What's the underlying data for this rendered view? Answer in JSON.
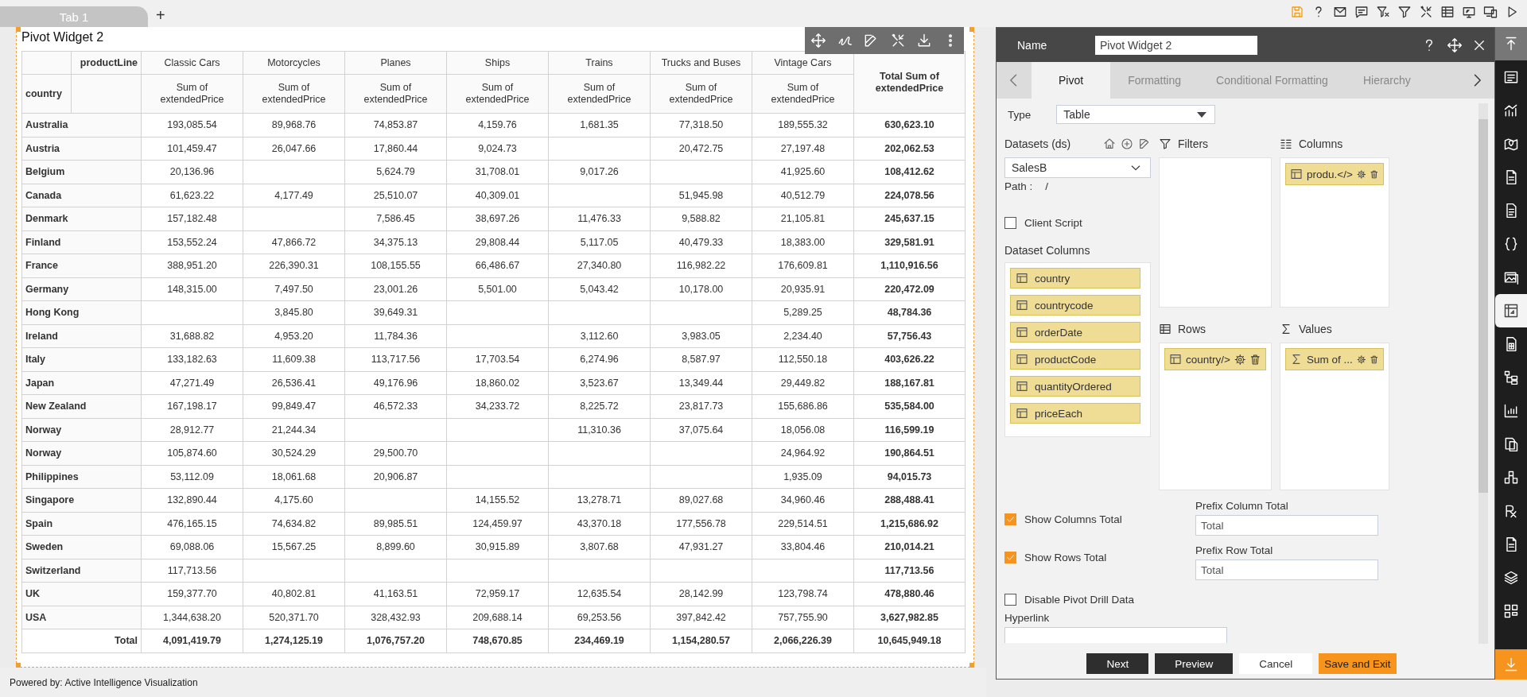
{
  "top_tabs": [
    {
      "label": "Tab 1",
      "selected": true
    }
  ],
  "add_tab": "+",
  "widget": {
    "title": "Pivot Widget 2",
    "pivot": {
      "column_field": "productLine",
      "row_field": "country",
      "columns": [
        {
          "name": "Classic Cars",
          "measure": "Sum of extendedPrice"
        },
        {
          "name": "Motorcycles",
          "measure": "Sum of extendedPrice"
        },
        {
          "name": "Planes",
          "measure": "Sum of extendedPrice"
        },
        {
          "name": "Ships",
          "measure": "Sum of extendedPrice"
        },
        {
          "name": "Trains",
          "measure": "Sum of extendedPrice"
        },
        {
          "name": "Trucks and Buses",
          "measure": "Sum of extendedPrice"
        },
        {
          "name": "Vintage Cars",
          "measure": "Sum of extendedPrice"
        }
      ],
      "total_header": "Total Sum of extendedPrice",
      "rows": [
        {
          "label": "Australia",
          "cells": [
            {
              "value": "193,085.54"
            },
            {
              "value": "89,968.76"
            },
            {
              "value": "74,853.87"
            },
            {
              "value": "4,159.76"
            },
            {
              "value": "1,681.35"
            },
            {
              "value": "77,318.50"
            },
            {
              "value": "189,555.32"
            }
          ],
          "total": "630,623.10"
        },
        {
          "label": "Austria",
          "cells": [
            {
              "value": "101,459.47"
            },
            {
              "value": "26,047.66"
            },
            {
              "value": "17,860.44"
            },
            {
              "value": "9,024.73"
            },
            {
              "kind": "empty"
            },
            {
              "value": "20,472.75"
            },
            {
              "value": "27,197.48"
            }
          ],
          "total": "202,062.53"
        },
        {
          "label": "Belgium",
          "cells": [
            {
              "value": "20,136.96"
            },
            {
              "kind": "empty"
            },
            {
              "value": "5,624.79"
            },
            {
              "value": "31,708.01"
            },
            {
              "value": "9,017.26"
            },
            {
              "kind": "empty"
            },
            {
              "value": "41,925.60"
            }
          ],
          "total": "108,412.62"
        },
        {
          "label": "Canada",
          "cells": [
            {
              "value": "61,623.22"
            },
            {
              "value": "4,177.49"
            },
            {
              "value": "25,510.07"
            },
            {
              "value": "40,309.01"
            },
            {
              "kind": "empty"
            },
            {
              "value": "51,945.98"
            },
            {
              "value": "40,512.79"
            }
          ],
          "total": "224,078.56"
        },
        {
          "label": "Denmark",
          "cells": [
            {
              "value": "157,182.48"
            },
            {
              "kind": "empty"
            },
            {
              "value": "7,586.45"
            },
            {
              "value": "38,697.26"
            },
            {
              "value": "11,476.33"
            },
            {
              "value": "9,588.82"
            },
            {
              "value": "21,105.81"
            }
          ],
          "total": "245,637.15"
        },
        {
          "label": "Finland",
          "cells": [
            {
              "value": "153,552.24"
            },
            {
              "value": "47,866.72"
            },
            {
              "value": "34,375.13"
            },
            {
              "value": "29,808.44"
            },
            {
              "value": "5,117.05"
            },
            {
              "value": "40,479.33"
            },
            {
              "value": "18,383.00"
            }
          ],
          "total": "329,581.91"
        },
        {
          "label": "France",
          "cells": [
            {
              "value": "388,951.20"
            },
            {
              "value": "226,390.31"
            },
            {
              "value": "108,155.55"
            },
            {
              "value": "66,486.67"
            },
            {
              "value": "27,340.80"
            },
            {
              "value": "116,982.22"
            },
            {
              "value": "176,609.81"
            }
          ],
          "total": "1,110,916.56"
        },
        {
          "label": "Germany",
          "cells": [
            {
              "value": "148,315.00"
            },
            {
              "value": "7,497.50"
            },
            {
              "value": "23,001.26"
            },
            {
              "value": "5,501.00"
            },
            {
              "value": "5,043.42"
            },
            {
              "value": "10,178.00"
            },
            {
              "value": "20,935.91"
            }
          ],
          "total": "220,472.09"
        },
        {
          "label": "Hong Kong",
          "cells": [
            {
              "kind": "empty"
            },
            {
              "value": "3,845.80"
            },
            {
              "value": "39,649.31"
            },
            {
              "kind": "empty"
            },
            {
              "kind": "empty"
            },
            {
              "kind": "empty"
            },
            {
              "value": "5,289.25"
            }
          ],
          "total": "48,784.36"
        },
        {
          "label": "Ireland",
          "cells": [
            {
              "value": "31,688.82"
            },
            {
              "value": "4,953.20"
            },
            {
              "value": "11,784.36"
            },
            {
              "kind": "empty"
            },
            {
              "value": "3,112.60"
            },
            {
              "value": "3,983.05"
            },
            {
              "value": "2,234.40"
            }
          ],
          "total": "57,756.43"
        },
        {
          "label": "Italy",
          "cells": [
            {
              "value": "133,182.63"
            },
            {
              "value": "11,609.38"
            },
            {
              "value": "113,717.56"
            },
            {
              "value": "17,703.54"
            },
            {
              "value": "6,274.96"
            },
            {
              "value": "8,587.97"
            },
            {
              "value": "112,550.18"
            }
          ],
          "total": "403,626.22"
        },
        {
          "label": "Japan",
          "cells": [
            {
              "value": "47,271.49"
            },
            {
              "value": "26,536.41"
            },
            {
              "value": "49,176.96"
            },
            {
              "value": "18,860.02"
            },
            {
              "value": "3,523.67"
            },
            {
              "value": "13,349.44"
            },
            {
              "value": "29,449.82"
            }
          ],
          "total": "188,167.81"
        },
        {
          "label": "New Zealand",
          "cells": [
            {
              "value": "167,198.17"
            },
            {
              "value": "99,849.47"
            },
            {
              "value": "46,572.33"
            },
            {
              "value": "34,233.72"
            },
            {
              "value": "8,225.72"
            },
            {
              "value": "23,817.73"
            },
            {
              "value": "155,686.86"
            }
          ],
          "total": "535,584.00"
        },
        {
          "label": "Norway",
          "cells": [
            {
              "value": "28,912.77"
            },
            {
              "value": "21,244.34"
            },
            {
              "kind": "empty"
            },
            {
              "kind": "empty"
            },
            {
              "value": "11,310.36"
            },
            {
              "value": "37,075.64"
            },
            {
              "value": "18,056.08"
            }
          ],
          "total": "116,599.19"
        },
        {
          "label": "Norway",
          "cells": [
            {
              "value": "105,874.60"
            },
            {
              "value": "30,524.29"
            },
            {
              "value": "29,500.70"
            },
            {
              "kind": "empty"
            },
            {
              "kind": "empty"
            },
            {
              "kind": "empty"
            },
            {
              "value": "24,964.92"
            }
          ],
          "total": "190,864.51"
        },
        {
          "label": "Philippines",
          "cells": [
            {
              "value": "53,112.09"
            },
            {
              "value": "18,061.68"
            },
            {
              "value": "20,906.87"
            },
            {
              "kind": "empty"
            },
            {
              "kind": "empty"
            },
            {
              "kind": "empty"
            },
            {
              "value": "1,935.09"
            }
          ],
          "total": "94,015.73"
        },
        {
          "label": "Singapore",
          "cells": [
            {
              "value": "132,890.44"
            },
            {
              "value": "4,175.60"
            },
            {
              "kind": "empty"
            },
            {
              "value": "14,155.52"
            },
            {
              "value": "13,278.71"
            },
            {
              "value": "89,027.68"
            },
            {
              "value": "34,960.46"
            }
          ],
          "total": "288,488.41"
        },
        {
          "label": "Spain",
          "cells": [
            {
              "value": "476,165.15"
            },
            {
              "value": "74,634.82"
            },
            {
              "value": "89,985.51"
            },
            {
              "value": "124,459.97"
            },
            {
              "value": "43,370.18"
            },
            {
              "value": "177,556.78"
            },
            {
              "value": "229,514.51"
            }
          ],
          "total": "1,215,686.92"
        },
        {
          "label": "Sweden",
          "cells": [
            {
              "value": "69,088.06"
            },
            {
              "value": "15,567.25"
            },
            {
              "value": "8,899.60"
            },
            {
              "value": "30,915.89"
            },
            {
              "value": "3,807.68"
            },
            {
              "value": "47,931.27"
            },
            {
              "value": "33,804.46"
            }
          ],
          "total": "210,014.21"
        },
        {
          "label": "Switzerland",
          "cells": [
            {
              "value": "117,713.56"
            },
            {
              "kind": "empty"
            },
            {
              "kind": "empty"
            },
            {
              "kind": "empty"
            },
            {
              "kind": "empty"
            },
            {
              "kind": "empty"
            },
            {
              "kind": "empty"
            }
          ],
          "total": "117,713.56"
        },
        {
          "label": "UK",
          "cells": [
            {
              "value": "159,377.70"
            },
            {
              "value": "40,802.81"
            },
            {
              "value": "41,163.51"
            },
            {
              "value": "72,959.17"
            },
            {
              "value": "12,635.54"
            },
            {
              "value": "28,142.99"
            },
            {
              "value": "123,798.74"
            }
          ],
          "total": "478,880.46"
        },
        {
          "label": "USA",
          "cells": [
            {
              "value": "1,344,638.20"
            },
            {
              "value": "520,371.70"
            },
            {
              "value": "328,432.93"
            },
            {
              "value": "209,688.14"
            },
            {
              "value": "69,253.56"
            },
            {
              "value": "397,842.42"
            },
            {
              "value": "757,755.90"
            }
          ],
          "total": "3,627,982.85"
        }
      ],
      "total_row": {
        "label": "Total",
        "values": [
          "4,091,419.79",
          "1,274,125.19",
          "1,076,757.20",
          "748,670.85",
          "234,469.19",
          "1,154,280.57",
          "2,066,226.39"
        ],
        "total": "10,645,949.18"
      }
    }
  },
  "editor": {
    "name_label": "Name",
    "name_value": "Pivot Widget 2",
    "tabs": [
      {
        "label": "Pivot",
        "selected": true
      },
      {
        "label": "Formatting",
        "selected": false
      },
      {
        "label": "Conditional Formatting",
        "selected": false
      },
      {
        "label": "Hierarchy",
        "selected": false
      }
    ],
    "type_label": "Type",
    "type_value": "Table",
    "datasets_label": "Datasets (ds)",
    "dataset_value": "SalesB",
    "path_label": "Path :",
    "path_value": "/",
    "client_script": {
      "label": "Client Script",
      "checked": false
    },
    "dataset_columns_label": "Dataset Columns",
    "dataset_columns": [
      "country",
      "countrycode",
      "orderDate",
      "productCode",
      "quantityOrdered",
      "priceEach"
    ],
    "filters_label": "Filters",
    "columns_label": "Columns",
    "columns_items": [
      {
        "label": "produ.</>",
        "kind": "field"
      }
    ],
    "rows_label": "Rows",
    "rows_items": [
      {
        "label": "country/>",
        "kind": "field"
      }
    ],
    "values_label": "Values",
    "values_items": [
      {
        "label": "Sum of ...",
        "kind": "measure"
      }
    ],
    "options": [
      {
        "label": "Show Columns Total",
        "checked": true
      },
      {
        "label": "Show Rows Total",
        "checked": true
      },
      {
        "label": "Disable Pivot Drill Data",
        "checked": false
      }
    ],
    "prefix_column_total": {
      "label": "Prefix Column Total",
      "value": "Total"
    },
    "prefix_row_total": {
      "label": "Prefix Row Total",
      "value": "Total"
    },
    "hyperlink_label": "Hyperlink",
    "buttons": [
      {
        "label": "Next",
        "kind": "dark"
      },
      {
        "label": "Preview",
        "kind": "dark"
      },
      {
        "label": "Cancel",
        "kind": "light"
      },
      {
        "label": "Save and Exit",
        "kind": "primary"
      }
    ]
  },
  "sidebar": {
    "items": [
      {
        "selected": false
      },
      {
        "selected": false
      },
      {
        "selected": false
      },
      {
        "selected": false
      },
      {
        "selected": false
      },
      {
        "selected": false
      },
      {
        "selected": false
      },
      {
        "selected": false
      },
      {
        "selected": true
      },
      {
        "selected": false
      },
      {
        "selected": false
      },
      {
        "selected": false
      },
      {
        "selected": false
      },
      {
        "selected": false
      },
      {
        "selected": false
      },
      {
        "selected": false
      },
      {
        "selected": false
      },
      {
        "selected": false
      }
    ]
  },
  "status_bar": "Powered by: Active Intelligence Visualization"
}
